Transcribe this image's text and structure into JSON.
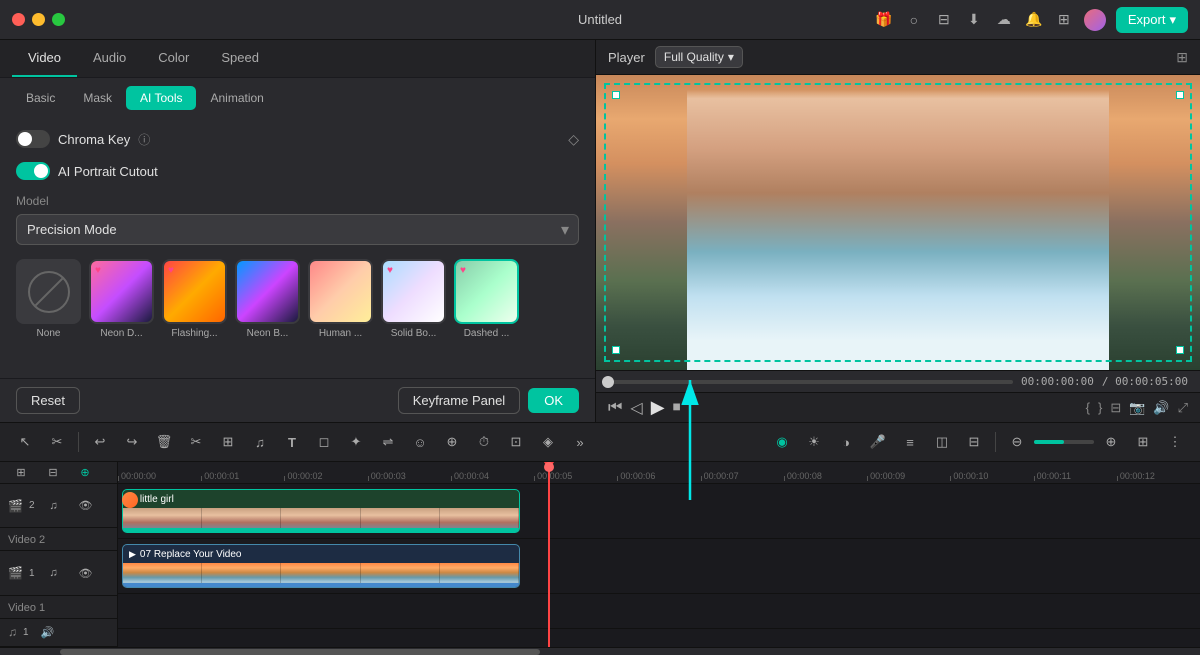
{
  "titlebar": {
    "title": "Untitled",
    "export_label": "Export"
  },
  "tabs": {
    "main": [
      "Video",
      "Audio",
      "Color",
      "Speed"
    ],
    "main_active": "Video",
    "sub": [
      "Basic",
      "Mask",
      "AI Tools",
      "Animation"
    ],
    "sub_active": "AI Tools"
  },
  "panel": {
    "chroma_key_label": "Chroma Key",
    "ai_portrait_label": "AI Portrait Cutout",
    "model_label": "Model",
    "model_value": "Precision Mode",
    "effects": [
      {
        "id": "none",
        "label": "None",
        "type": "none"
      },
      {
        "id": "neon-d",
        "label": "Neon D...",
        "type": "neon-d",
        "heart": true
      },
      {
        "id": "flashing",
        "label": "Flashing...",
        "type": "flashing",
        "heart": true
      },
      {
        "id": "neon-b",
        "label": "Neon B...",
        "type": "neon-b"
      },
      {
        "id": "human",
        "label": "Human ...",
        "type": "human"
      },
      {
        "id": "solid-b",
        "label": "Solid Bo...",
        "type": "solid-b",
        "heart": true
      },
      {
        "id": "dashed",
        "label": "Dashed ...",
        "type": "dashed",
        "heart": true
      }
    ],
    "selected_effect": "dashed",
    "reset_label": "Reset",
    "keyframe_label": "Keyframe Panel",
    "ok_label": "OK"
  },
  "player": {
    "label": "Player",
    "quality": "Full Quality",
    "time_current": "00:00:00:00",
    "time_total": "/ 00:00:05:00"
  },
  "timeline": {
    "ruler_marks": [
      "00:00:00",
      "00:00:01",
      "00:00:02",
      "00:00:03",
      "00:00:04",
      "00:00:05",
      "00:00:06",
      "00:00:07",
      "00:00:08",
      "00:00:09",
      "00:00:10",
      "00:00:11",
      "00:00:12"
    ],
    "tracks": [
      {
        "id": "video2",
        "label": "Video 2",
        "num": "2",
        "clip_title": "little girl"
      },
      {
        "id": "video1",
        "label": "Video 1",
        "num": "1",
        "clip_title": "07 Replace Your Video"
      },
      {
        "id": "audio1",
        "label": "♪1",
        "num": "1"
      }
    ]
  },
  "colors": {
    "accent": "#00c4a0",
    "accent_dark": "#009a7c"
  },
  "icons": {
    "play": "▶",
    "pause": "⏸",
    "skip_back": "⏮",
    "skip_forward": "⏭",
    "stop": "⏹",
    "volume": "🔊",
    "chevron_down": "▾",
    "close": "✕",
    "diamond": "◇",
    "heart": "♥",
    "scissors": "✂",
    "undo": "↩",
    "redo": "↪",
    "trash": "🗑",
    "crop": "⊞",
    "text": "T",
    "shape": "◻",
    "zoom_in": "⊕",
    "zoom_out": "⊖",
    "grid": "⊞",
    "split": "||"
  }
}
